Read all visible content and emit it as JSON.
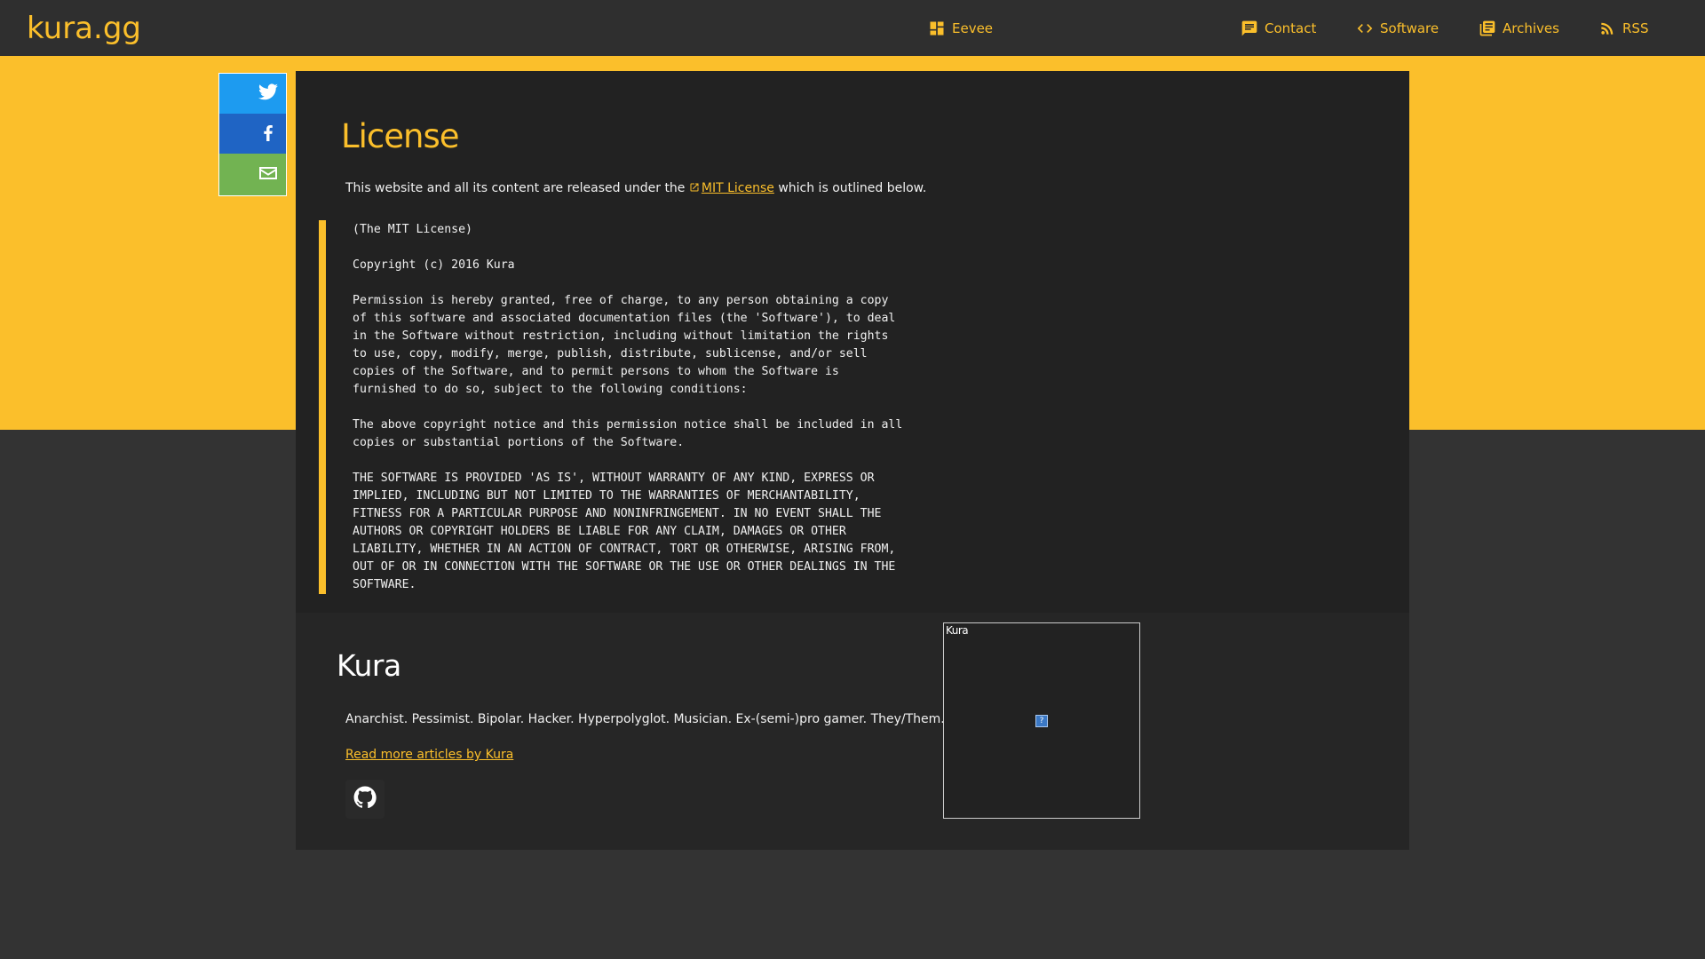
{
  "site": {
    "brand": "kura.gg"
  },
  "nav": [
    {
      "label": "Eevee",
      "icon": "dashboard-icon"
    },
    {
      "label": "Contact",
      "icon": "chat-icon"
    },
    {
      "label": "Software",
      "icon": "code-icon"
    },
    {
      "label": "Archives",
      "icon": "library-icon"
    },
    {
      "label": "RSS",
      "icon": "rss-icon"
    }
  ],
  "share": [
    {
      "network": "Twitter",
      "icon": "twitter-icon",
      "color": "#1d9bf0"
    },
    {
      "network": "Facebook",
      "icon": "facebook-icon",
      "color": "#1f64c4"
    },
    {
      "network": "Email",
      "icon": "mail-icon",
      "color": "#72b352"
    }
  ],
  "article": {
    "title": "License",
    "intro_before": "This website and all its content are released under the ",
    "intro_link": "MIT License",
    "intro_after": " which is outlined below.",
    "license_text": "(The MIT License)\n\nCopyright (c) 2016 Kura\n\nPermission is hereby granted, free of charge, to any person obtaining a copy\nof this software and associated documentation files (the 'Software'), to deal\nin the Software without restriction, including without limitation the rights\nto use, copy, modify, merge, publish, distribute, sublicense, and/or sell\ncopies of the Software, and to permit persons to whom the Software is\nfurnished to do so, subject to the following conditions:\n\nThe above copyright notice and this permission notice shall be included in all\ncopies or substantial portions of the Software.\n\nTHE SOFTWARE IS PROVIDED 'AS IS', WITHOUT WARRANTY OF ANY KIND, EXPRESS OR\nIMPLIED, INCLUDING BUT NOT LIMITED TO THE WARRANTIES OF MERCHANTABILITY,\nFITNESS FOR A PARTICULAR PURPOSE AND NONINFRINGEMENT. IN NO EVENT SHALL THE\nAUTHORS OR COPYRIGHT HOLDERS BE LIABLE FOR ANY CLAIM, DAMAGES OR OTHER\nLIABILITY, WHETHER IN AN ACTION OF CONTRACT, TORT OR OTHERWISE, ARISING FROM,\nOUT OF OR IN CONNECTION WITH THE SOFTWARE OR THE USE OR OTHER DEALINGS IN THE\nSOFTWARE."
  },
  "author": {
    "name": "Kura",
    "bio": "Anarchist. Pessimist. Bipolar. Hacker. Hyperpolyglot. Musician. Ex-(semi-)pro gamer. They/Them.",
    "more_link": "Read more articles by Kura",
    "avatar_alt": "Kura",
    "social_icon": "github-icon"
  },
  "colors": {
    "accent": "#fbbf2b",
    "header_bg": "#2f2f2f",
    "page_bg": "#333333",
    "article_bg": "#222222"
  }
}
